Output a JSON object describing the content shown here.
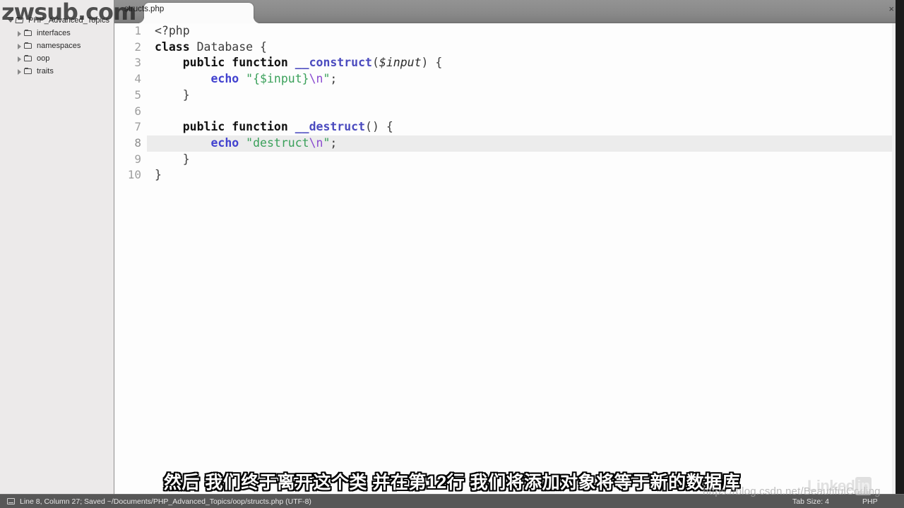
{
  "window": {
    "app": "Sublime Text",
    "title": "structs.php"
  },
  "sidebar": {
    "root": {
      "label": "PHP_Advanced_Topics",
      "expanded": true,
      "icon": "folder-open-icon"
    },
    "items": [
      {
        "label": "interfaces",
        "expanded": false,
        "icon": "folder-icon"
      },
      {
        "label": "namespaces",
        "expanded": false,
        "icon": "folder-icon"
      },
      {
        "label": "oop",
        "expanded": false,
        "icon": "folder-icon"
      },
      {
        "label": "traits",
        "expanded": false,
        "icon": "folder-icon"
      }
    ]
  },
  "tabs": [
    {
      "label": "structs.php",
      "active": true,
      "close_label": "×"
    }
  ],
  "editor": {
    "current_line": 8,
    "line_numbers": [
      "1",
      "2",
      "3",
      "4",
      "5",
      "6",
      "7",
      "8",
      "9",
      "10"
    ],
    "lines": [
      {
        "n": 1,
        "text": "<?php"
      },
      {
        "n": 2,
        "text": "class Database {"
      },
      {
        "n": 3,
        "text": "    public function __construct($input) {"
      },
      {
        "n": 4,
        "text": "        echo \"{$input}\\n\";"
      },
      {
        "n": 5,
        "text": "    }"
      },
      {
        "n": 6,
        "text": ""
      },
      {
        "n": 7,
        "text": "    public function __destruct() {"
      },
      {
        "n": 8,
        "text": "        echo \"destruct\\n\";"
      },
      {
        "n": 9,
        "text": "    }"
      },
      {
        "n": 10,
        "text": "}"
      }
    ]
  },
  "statusbar": {
    "position": "Line 8, Column 27; Saved ~/Documents/PHP_Advanced_Topics/oop/structs.php (UTF-8)",
    "tab_size": "Tab Size: 4",
    "language": "PHP",
    "icon": "document-icon"
  },
  "subtitle": {
    "text": "然后 我们终于离开这个类 并在第12行 我们将添加对象将等于新的数据库"
  },
  "watermarks": {
    "top_left": "zwsub.com",
    "bottom_url": "https://blog.csdn.net/BeautifulCoding",
    "brand": "Linked",
    "brand_suffix": "in"
  },
  "colors": {
    "sidebar_bg": "#eceaea",
    "tabbar_bg": "#8a8a8a",
    "editor_bg": "#fdfdfd",
    "statusbar_bg": "#575757",
    "current_line_hl": "#ececec",
    "gutter_hl": "#dedede",
    "keyword": "#111111",
    "function_name": "#4b4bbf",
    "echo_keyword": "#4242cf",
    "string": "#3aa05a",
    "escape": "#8a4bd0"
  }
}
